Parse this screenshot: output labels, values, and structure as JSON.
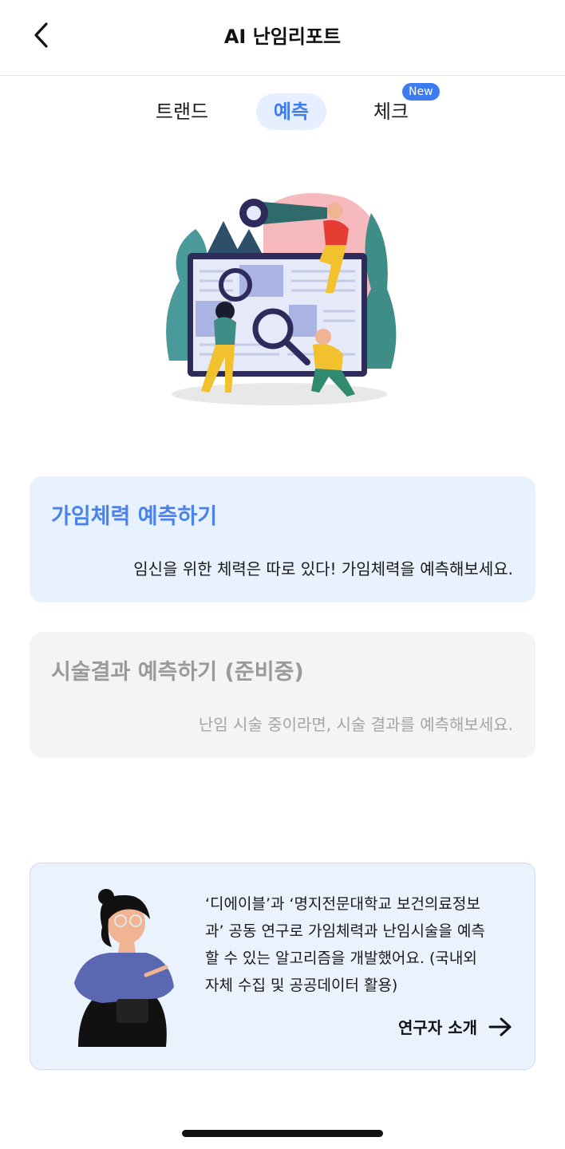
{
  "header": {
    "title": "AI 난임리포트",
    "back_icon": "chevron-left-icon"
  },
  "tabs": [
    {
      "label": "트랜드",
      "active": false
    },
    {
      "label": "예측",
      "active": true
    },
    {
      "label": "체크",
      "active": false,
      "badge": "New"
    }
  ],
  "colors": {
    "accent": "#3d7cf0",
    "card_active_bg": "#e8f1fe",
    "card_disabled_bg": "#f4f4f4",
    "info_bg": "#eaf2fe"
  },
  "hero": {
    "illustration": "research-team-illustration"
  },
  "cards": [
    {
      "title": "가임체력 예측하기",
      "description": "임신을 위한 체력은 따로 있다!  가임체력을 예측해보세요.",
      "enabled": true
    },
    {
      "title": "시술결과 예측하기 (준비중)",
      "description": "난임 시술 중이라면, 시술 결과를 예측해보세요.",
      "enabled": false
    }
  ],
  "info": {
    "illustration": "researcher-illustration",
    "text_lines": [
      "‘디에이블’과 ‘명지전문대학교 보건의료정보",
      "과’ 공동 연구로 가임체력과 난임시술을 예측",
      "할 수 있는 알고리즘을 개발했어요. (국내외",
      "자체 수집 및 공공데이터 활용)"
    ],
    "link_label": "연구자 소개",
    "link_icon": "arrow-right-icon"
  }
}
